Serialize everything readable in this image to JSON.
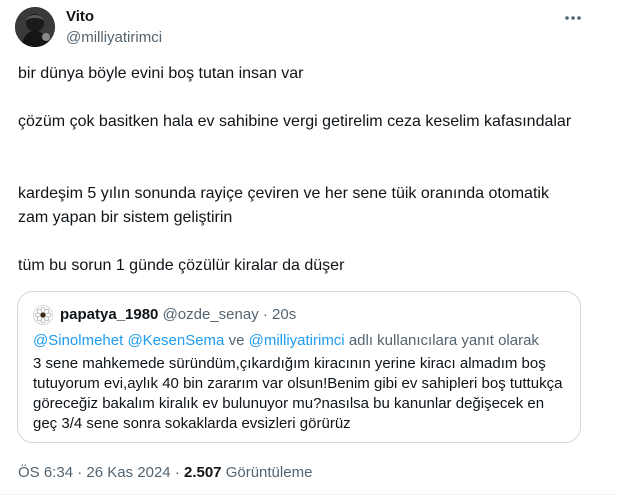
{
  "author": {
    "name": "Vito",
    "handle": "@milliyatirimci",
    "avatar_icon": "dark-portrait-avatar"
  },
  "more_icon": "more-horizontal-icon",
  "tweet": {
    "paragraphs": [
      "bir dünya böyle evini boş tutan insan var",
      "çözüm çok basitken hala ev sahibine vergi getirelim ceza keselim kafasındalar",
      "kardeşim 5 yılın sonunda rayiçe çeviren ve her sene tüik oranında otomatik zam yapan bir sistem geliştirin",
      "tüm bu sorun 1 günde çözülür kiralar da düşer"
    ]
  },
  "quoted": {
    "name": "papatya_1980",
    "handle": "@ozde_senay",
    "dot": "·",
    "time": "20s",
    "avatar_icon": "daisy-flower-icon",
    "reply_mentions": [
      "@Sinolmehet",
      "@KesenSema",
      "@milliyatirimci"
    ],
    "reply_connector": "ve",
    "reply_suffix": "adlı kullanıcılara yanıt olarak",
    "text": "3 sene mahkemede süründüm,çıkardığım kiracının yerine kiracı almadım boş tutuyorum evi,aylık 40 bin zararım var olsun!Benim gibi ev sahipleri boş tuttukça göreceğiz bakalım kiralık ev bulunuyor mu?nasılsa bu kanunlar değişecek en geç 3/4 sene sonra sokaklarda evsizleri görürüz"
  },
  "meta": {
    "time": "ÖS 6:34",
    "sep1": "·",
    "date": "26 Kas 2024",
    "sep2": "·",
    "views_count": "2.507",
    "views_label": "Görüntüleme"
  },
  "colors": {
    "text_primary": "#0f1419",
    "text_secondary": "#536471",
    "link": "#1d9bf0",
    "border": "#cfd9de"
  }
}
